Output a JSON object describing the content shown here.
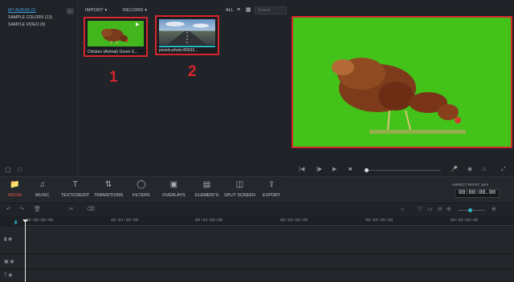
{
  "library": {
    "albums": [
      "MY ALBUM (2)",
      "SAMPLE COLORS (13)",
      "SAMPLE VIDEO (9)"
    ],
    "collapse_icon": "arrow-left-icon"
  },
  "media": {
    "import_label": "IMPORT",
    "record_label": "RECORD",
    "filter_label": "ALL",
    "search_placeholder": "Search",
    "clips": [
      {
        "label": "Chicken (Animal) Green S...",
        "type": "video"
      },
      {
        "label": "pexels-photo-80633...",
        "type": "image"
      }
    ],
    "annotations": [
      "1",
      "2"
    ]
  },
  "toolbar": {
    "items": [
      "MEDIA",
      "MUSIC",
      "TEXT/CREDIT",
      "TRANSITIONS",
      "FILTERS",
      "OVERLAYS",
      "ELEMENTS",
      "SPLIT SCREEN",
      "EXPORT"
    ],
    "aspect_ratio": "ASPECT RATIO: 16:9",
    "timecode": "00:00:00.00"
  },
  "timeline": {
    "ticks": [
      "00:00:00:00",
      "00:01:00:00",
      "00:02:00:00",
      "00:03:00:00",
      "00:04:00:00",
      "00:05:00:00"
    ]
  },
  "colors": {
    "accent": "#e8534a",
    "highlight": "#d5262c",
    "green_screen": "#43c21a",
    "link": "#3fa2e6"
  }
}
